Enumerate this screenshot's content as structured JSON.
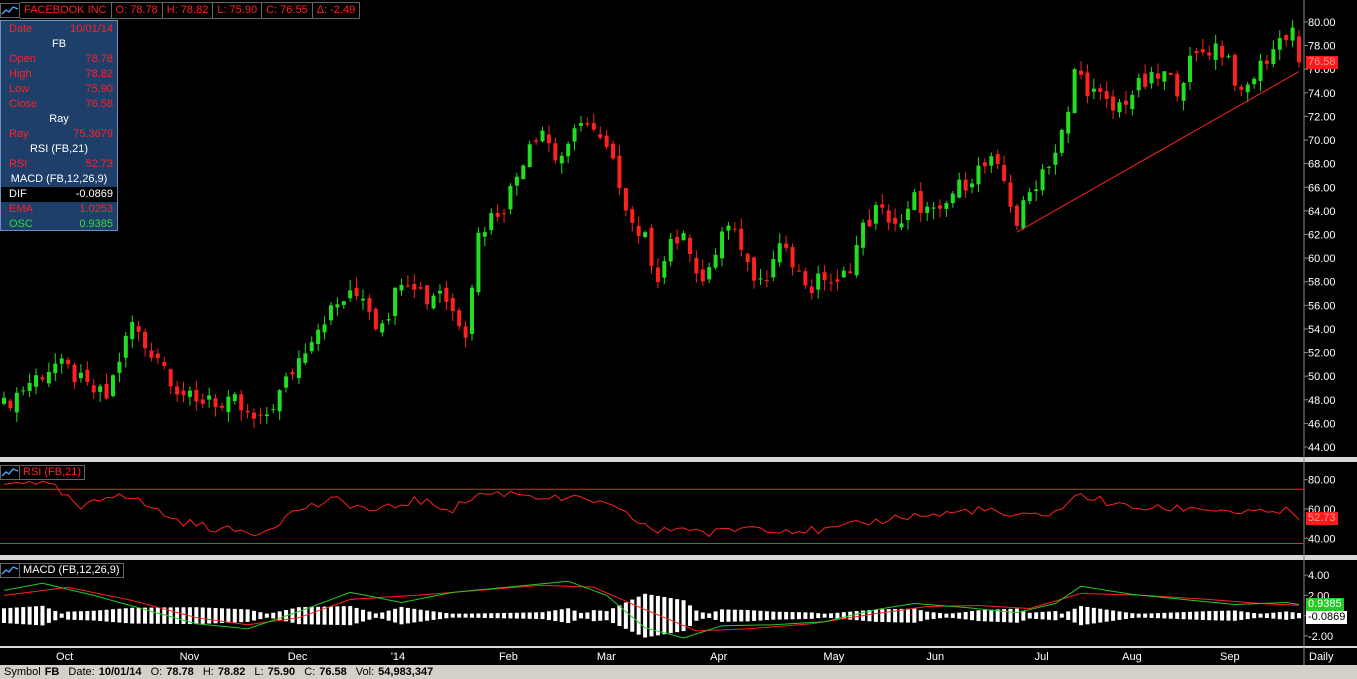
{
  "topbar": {
    "title": "FACEBOOK INC",
    "open": "O: 78.78",
    "high": "H: 78.82",
    "low": "L: 75.90",
    "close": "C: 76.55",
    "change": "Δ: -2.49"
  },
  "info": {
    "date_label": "Date",
    "date_value": "10/01/14",
    "symbol": "FB",
    "open_label": "Open",
    "open_value": "78.78",
    "high_label": "High",
    "high_value": "78.82",
    "low_label": "Low",
    "low_value": "75.90",
    "close_label": "Close",
    "close_value": "76.58",
    "ray_header": "Ray",
    "ray_label": "Ray",
    "ray_value": "75.3679",
    "rsi_header": "RSI (FB,21)",
    "rsi_label": "RSI",
    "rsi_value": "52.73",
    "macd_header": "MACD (FB,12,26,9)",
    "dif_label": "DIF",
    "dif_value": "-0.0869",
    "ema_label": "EMA",
    "ema_value": "1.0253",
    "osc_label": "OSC",
    "osc_value": "0.9385"
  },
  "rsi_panel": {
    "label": "RSI (FB,21)",
    "flag": "52.73"
  },
  "macd_panel": {
    "label": "MACD (FB,12,26,9)",
    "flag_osc": "0.9385",
    "flag_dif": "-0.0869"
  },
  "price_flag": "76.58",
  "status": {
    "symbol_label": "Symbol",
    "symbol": "FB",
    "date_label": "Date:",
    "date": "10/01/14",
    "o_label": "O:",
    "o": "78.78",
    "h_label": "H:",
    "h": "78.82",
    "l_label": "L:",
    "l": "75.90",
    "c_label": "C:",
    "c": "76.58",
    "vol_label": "Vol:",
    "vol": "54,983,347"
  },
  "colors": {
    "up": "#22dd22",
    "down": "#ff2020",
    "bg": "#000000",
    "grid_text": "#ffffff"
  },
  "chart_data": [
    {
      "type": "candlestick",
      "title": "",
      "x_ticks": [
        "Oct",
        "Nov",
        "Dec",
        "'14",
        "Feb",
        "Mar",
        "Apr",
        "May",
        "Jun",
        "Jul",
        "Aug",
        "Sep",
        "Daily"
      ],
      "ylim": [
        43,
        81
      ],
      "y_ticks": [
        44,
        46,
        48,
        50,
        52,
        54,
        56,
        58,
        60,
        62,
        64,
        66,
        68,
        70,
        72,
        74,
        76,
        78,
        80
      ],
      "y_tick_labels": [
        "44.00",
        "46.00",
        "48.00",
        "50.00",
        "52.00",
        "54.00",
        "56.00",
        "58.00",
        "60.00",
        "62.00",
        "64.00",
        "66.00",
        "68.00",
        "70.00",
        "72.00",
        "74.00",
        "76.00",
        "78.00",
        "80.00"
      ],
      "close_path": [
        [
          0,
          47.5
        ],
        [
          4,
          49.5
        ],
        [
          8,
          51.0
        ],
        [
          10,
          50.5
        ],
        [
          13,
          49.0
        ],
        [
          16,
          48.2
        ],
        [
          18,
          51.5
        ],
        [
          20,
          54.5
        ],
        [
          22,
          52.5
        ],
        [
          24,
          51.8
        ],
        [
          27,
          49.0
        ],
        [
          30,
          47.5
        ],
        [
          32,
          48.5
        ],
        [
          34,
          47.2
        ],
        [
          36,
          47.8
        ],
        [
          38,
          46.5
        ],
        [
          40,
          46.0
        ],
        [
          43,
          48.5
        ],
        [
          46,
          51.5
        ],
        [
          48,
          53.5
        ],
        [
          50,
          55.0
        ],
        [
          53,
          56.5
        ],
        [
          56,
          57.0
        ],
        [
          58,
          54.5
        ],
        [
          60,
          55.5
        ],
        [
          62,
          58.5
        ],
        [
          64,
          58.0
        ],
        [
          66,
          56.5
        ],
        [
          68,
          57.5
        ],
        [
          70,
          55.5
        ],
        [
          72,
          54.0
        ],
        [
          74,
          62.0
        ],
        [
          76,
          63.5
        ],
        [
          78,
          64.5
        ],
        [
          80,
          67.0
        ],
        [
          82,
          70.0
        ],
        [
          84,
          71.0
        ],
        [
          86,
          68.5
        ],
        [
          88,
          69.0
        ],
        [
          90,
          72.0
        ],
        [
          92,
          70.5
        ],
        [
          94,
          69.0
        ],
        [
          96,
          66.5
        ],
        [
          98,
          63.0
        ],
        [
          100,
          61.5
        ],
        [
          102,
          58.5
        ],
        [
          104,
          61.0
        ],
        [
          106,
          62.0
        ],
        [
          108,
          58.0
        ],
        [
          110,
          59.0
        ],
        [
          112,
          63.0
        ],
        [
          114,
          62.5
        ],
        [
          116,
          59.0
        ],
        [
          118,
          57.5
        ],
        [
          120,
          59.5
        ],
        [
          122,
          61.5
        ],
        [
          124,
          58.5
        ],
        [
          126,
          57.5
        ],
        [
          128,
          58.5
        ],
        [
          130,
          57.5
        ],
        [
          132,
          59.5
        ],
        [
          134,
          62.5
        ],
        [
          136,
          64.0
        ],
        [
          138,
          63.5
        ],
        [
          140,
          62.5
        ],
        [
          142,
          65.0
        ],
        [
          144,
          64.0
        ],
        [
          146,
          63.5
        ],
        [
          148,
          65.5
        ],
        [
          150,
          66.5
        ],
        [
          152,
          67.5
        ],
        [
          154,
          68.0
        ],
        [
          156,
          66.5
        ],
        [
          158,
          63.0
        ],
        [
          160,
          65.5
        ],
        [
          162,
          67.5
        ],
        [
          164,
          69.0
        ],
        [
          166,
          72.0
        ],
        [
          167,
          76.0
        ],
        [
          169,
          74.5
        ],
        [
          171,
          73.5
        ],
        [
          173,
          72.5
        ],
        [
          175,
          73.5
        ],
        [
          177,
          74.5
        ],
        [
          179,
          75.0
        ],
        [
          181,
          75.5
        ],
        [
          183,
          74.5
        ],
        [
          185,
          76.5
        ],
        [
          187,
          77.5
        ],
        [
          189,
          78.0
        ],
        [
          191,
          77.0
        ],
        [
          193,
          73.5
        ],
        [
          195,
          75.5
        ],
        [
          197,
          77.0
        ],
        [
          199,
          78.5
        ],
        [
          201,
          79.5
        ],
        [
          202,
          76.58
        ]
      ],
      "candle_count": 253,
      "last_close": 76.58,
      "annotations": [
        {
          "type": "ray",
          "from_index": 158,
          "from_value": 62.2,
          "to_index": 202,
          "to_value": 75.8
        }
      ]
    },
    {
      "type": "line",
      "name": "RSI (FB,21)",
      "ylim": [
        30,
        90
      ],
      "y_ticks": [
        40,
        60,
        80
      ],
      "y_tick_labels": [
        "40.00",
        "60.00",
        "80.00"
      ],
      "bands": [
        36.5,
        73.5
      ],
      "values_path": [
        [
          0,
          76
        ],
        [
          4,
          80
        ],
        [
          8,
          74
        ],
        [
          12,
          60
        ],
        [
          18,
          72
        ],
        [
          22,
          63
        ],
        [
          27,
          52
        ],
        [
          34,
          46
        ],
        [
          40,
          44
        ],
        [
          46,
          60
        ],
        [
          52,
          66
        ],
        [
          58,
          58
        ],
        [
          64,
          66
        ],
        [
          70,
          60
        ],
        [
          74,
          70
        ],
        [
          80,
          71
        ],
        [
          86,
          67
        ],
        [
          92,
          66
        ],
        [
          98,
          54
        ],
        [
          102,
          44
        ],
        [
          106,
          48
        ],
        [
          110,
          43
        ],
        [
          116,
          48
        ],
        [
          122,
          46
        ],
        [
          128,
          45
        ],
        [
          134,
          50
        ],
        [
          140,
          55
        ],
        [
          146,
          56
        ],
        [
          152,
          60
        ],
        [
          158,
          54
        ],
        [
          164,
          58
        ],
        [
          168,
          70
        ],
        [
          174,
          62
        ],
        [
          180,
          60
        ],
        [
          186,
          61
        ],
        [
          192,
          58
        ],
        [
          196,
          57
        ],
        [
          200,
          59
        ],
        [
          202,
          52.73
        ]
      ],
      "last_value": 52.73
    },
    {
      "type": "macd",
      "name": "MACD (FB,12,26,9)",
      "ylim": [
        -2.7,
        5.0
      ],
      "y_ticks": [
        -2,
        0,
        2,
        4
      ],
      "y_tick_labels": [
        "-2.00",
        "",
        "2.00",
        "4.00"
      ],
      "dif_path": [
        [
          0,
          2.5
        ],
        [
          6,
          3.2
        ],
        [
          14,
          2.0
        ],
        [
          22,
          0.6
        ],
        [
          30,
          -0.8
        ],
        [
          38,
          -1.3
        ],
        [
          46,
          0.4
        ],
        [
          54,
          2.3
        ],
        [
          62,
          1.3
        ],
        [
          70,
          2.3
        ],
        [
          80,
          2.9
        ],
        [
          88,
          3.4
        ],
        [
          94,
          2.0
        ],
        [
          100,
          -1.2
        ],
        [
          106,
          -2.2
        ],
        [
          112,
          -1.0
        ],
        [
          120,
          -0.9
        ],
        [
          128,
          -0.6
        ],
        [
          136,
          0.6
        ],
        [
          142,
          1.2
        ],
        [
          150,
          0.8
        ],
        [
          158,
          0.3
        ],
        [
          164,
          1.2
        ],
        [
          168,
          2.9
        ],
        [
          176,
          2.1
        ],
        [
          184,
          1.6
        ],
        [
          192,
          1.1
        ],
        [
          200,
          1.3
        ],
        [
          202,
          1.1
        ]
      ],
      "ema_path": [
        [
          0,
          2.0
        ],
        [
          10,
          2.8
        ],
        [
          20,
          1.5
        ],
        [
          30,
          -0.2
        ],
        [
          38,
          -0.9
        ],
        [
          46,
          -0.2
        ],
        [
          54,
          1.6
        ],
        [
          64,
          2.0
        ],
        [
          74,
          2.5
        ],
        [
          84,
          3.0
        ],
        [
          92,
          2.8
        ],
        [
          100,
          0.6
        ],
        [
          108,
          -1.5
        ],
        [
          116,
          -1.3
        ],
        [
          126,
          -0.8
        ],
        [
          136,
          0.2
        ],
        [
          144,
          0.9
        ],
        [
          152,
          1.0
        ],
        [
          160,
          0.7
        ],
        [
          168,
          2.2
        ],
        [
          178,
          2.0
        ],
        [
          188,
          1.6
        ],
        [
          196,
          1.2
        ],
        [
          202,
          1.0253
        ]
      ],
      "last_dif": -0.0869,
      "last_ema": 1.0253,
      "last_osc": 0.9385
    }
  ]
}
